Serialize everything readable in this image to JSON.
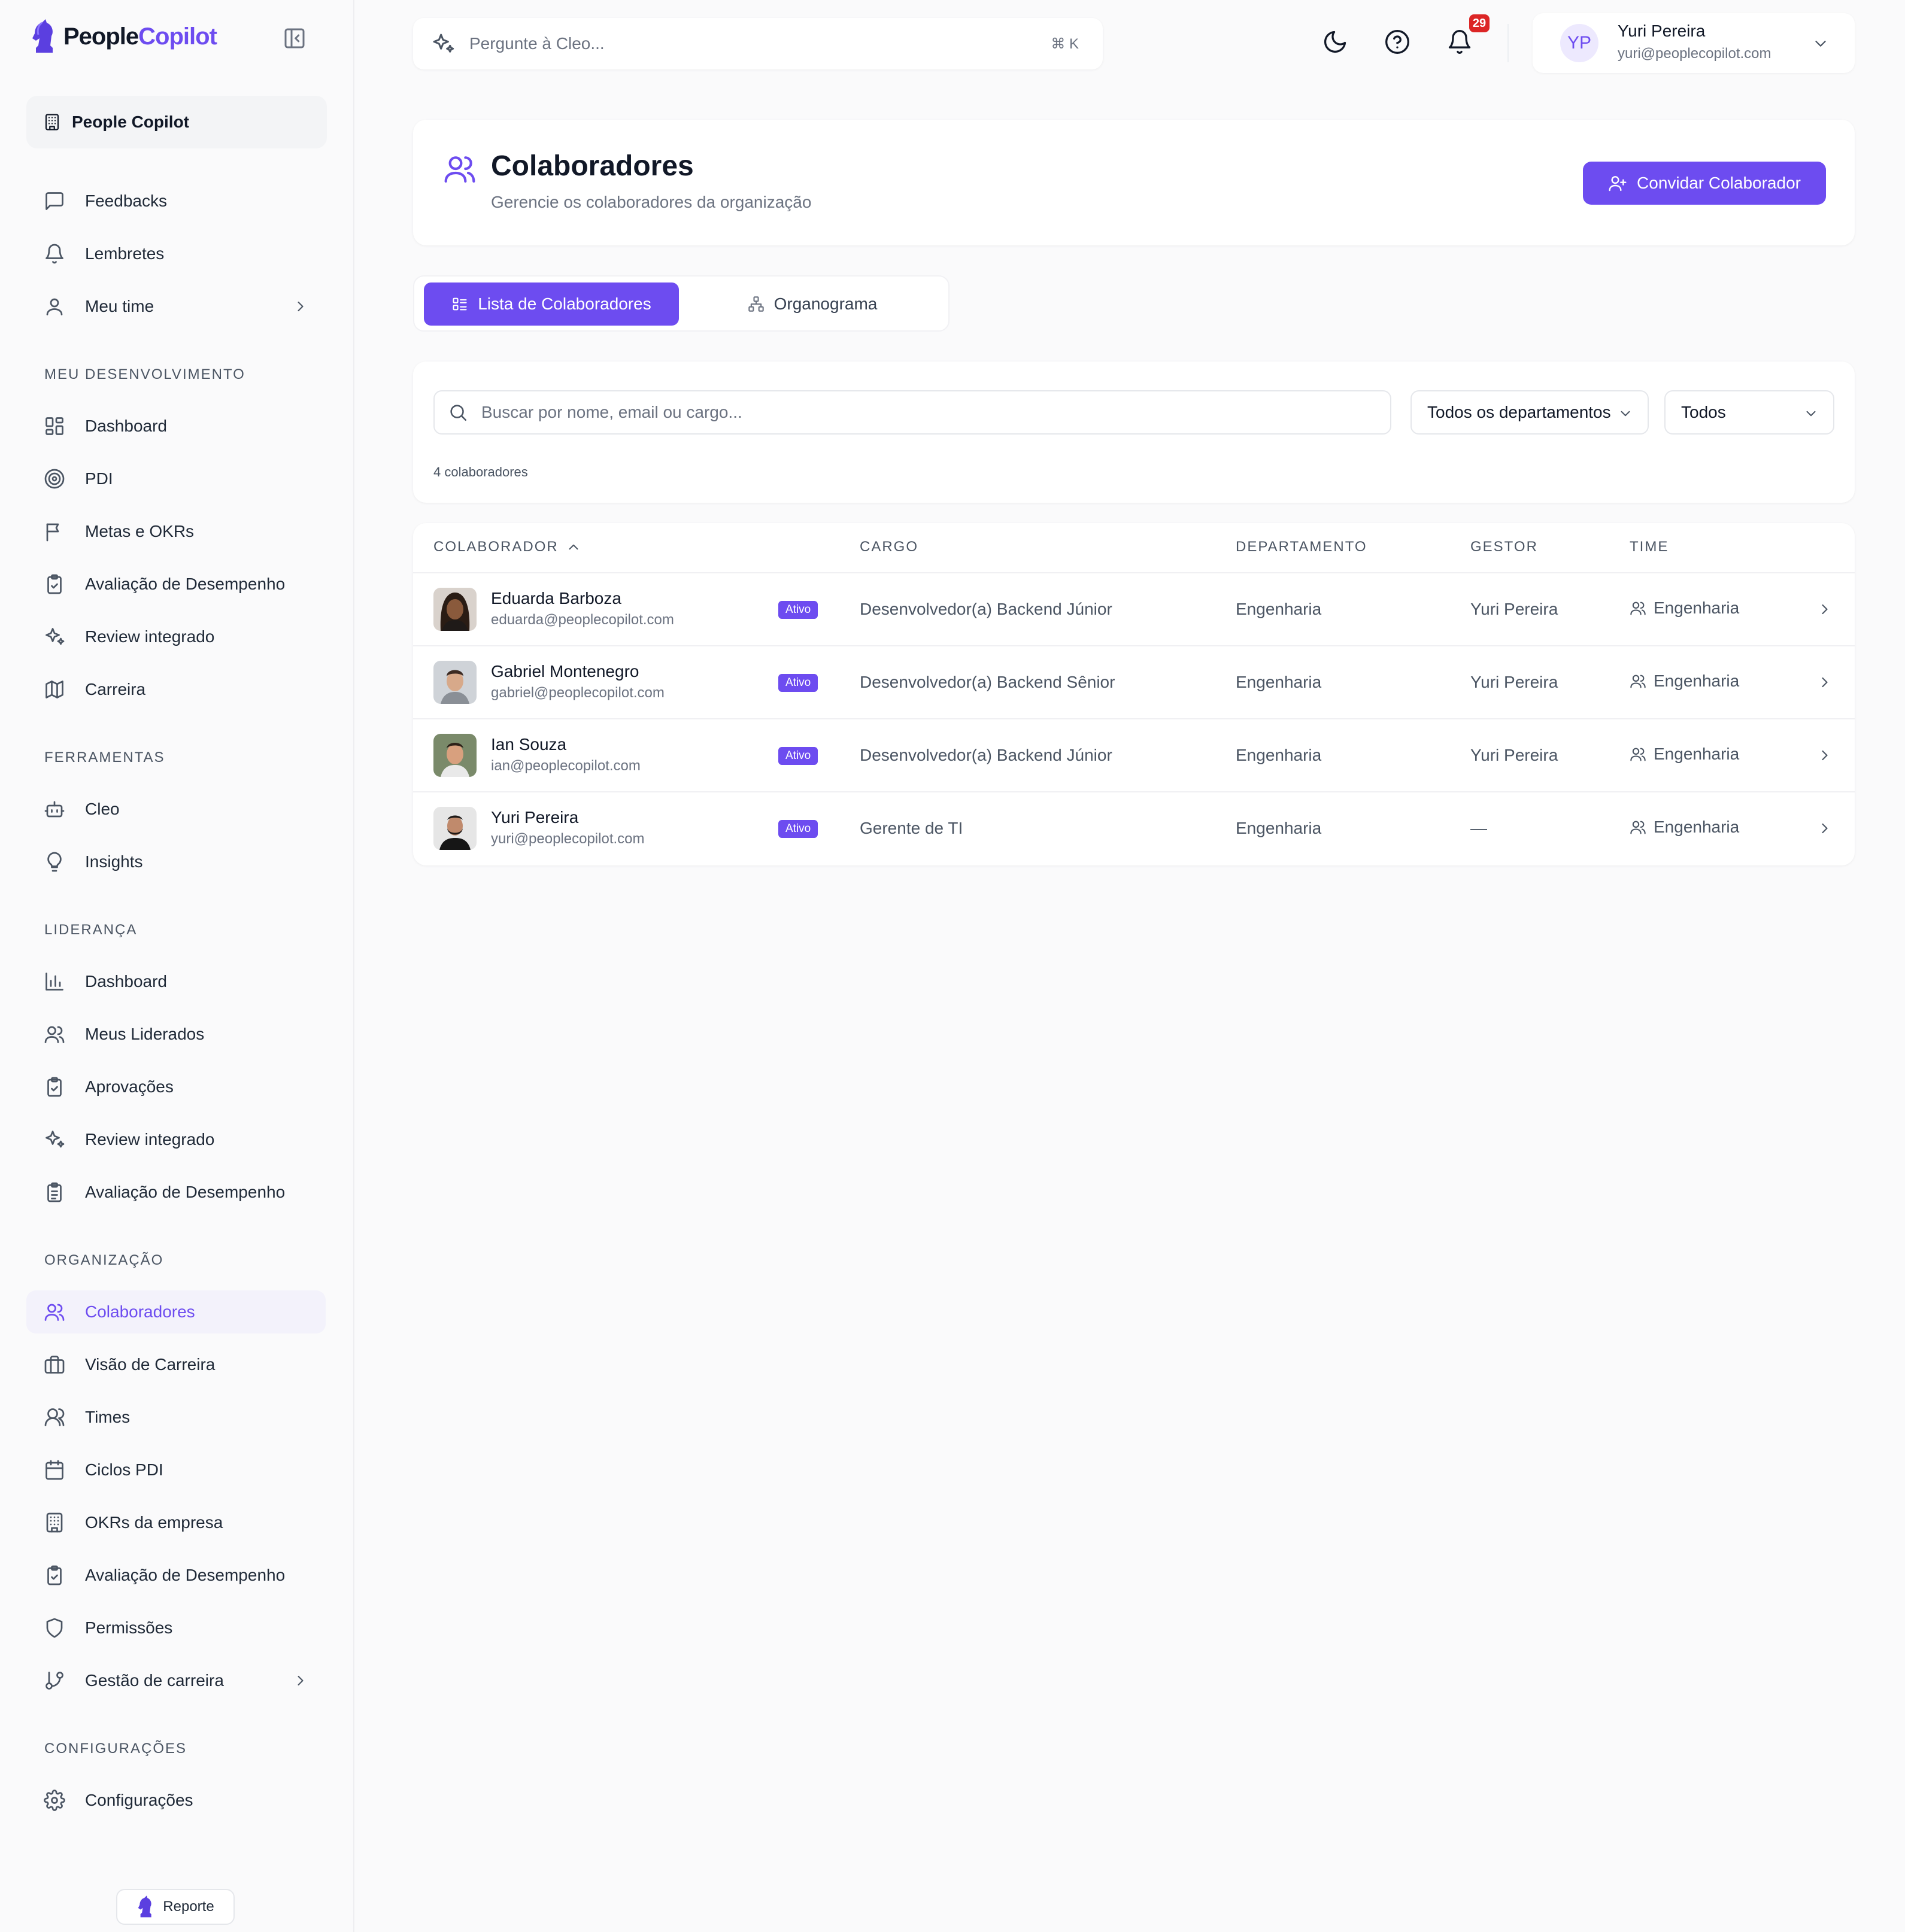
{
  "brand": {
    "name_part1": "People",
    "name_part2": "Copilot",
    "accent": "#6d4cf0"
  },
  "sidebar": {
    "org_name": "People Copilot",
    "top_items": [
      {
        "label": "Feedbacks",
        "icon": "message-square-icon"
      },
      {
        "label": "Lembretes",
        "icon": "bell-icon"
      },
      {
        "label": "Meu time",
        "icon": "user-icon"
      }
    ],
    "sections": {
      "dev": "MEU DESENVOLVIMENTO",
      "tools": "FERRAMENTAS",
      "lead": "LIDERANÇA",
      "org": "ORGANIZAÇÃO",
      "config": "CONFIGURAÇÕES"
    },
    "dev_items": [
      {
        "label": "Dashboard",
        "icon": "layout-dashboard-icon"
      },
      {
        "label": "PDI",
        "icon": "target-icon"
      },
      {
        "label": "Metas e OKRs",
        "icon": "flag-icon"
      },
      {
        "label": "Avaliação de Desempenho",
        "icon": "clipboard-check-icon"
      },
      {
        "label": "Review integrado",
        "icon": "sparkles-icon"
      },
      {
        "label": "Carreira",
        "icon": "map-icon"
      }
    ],
    "tools_items": [
      {
        "label": "Cleo",
        "icon": "bot-icon"
      },
      {
        "label": "Insights",
        "icon": "lightbulb-icon"
      }
    ],
    "lead_items": [
      {
        "label": "Dashboard",
        "icon": "bar-chart-icon"
      },
      {
        "label": "Meus Liderados",
        "icon": "users-icon"
      },
      {
        "label": "Aprovações",
        "icon": "clipboard-check-icon"
      },
      {
        "label": "Review integrado",
        "icon": "sparkles-icon"
      },
      {
        "label": "Avaliação de Desempenho",
        "icon": "clipboard-list-icon"
      }
    ],
    "org_items": [
      {
        "label": "Colaboradores",
        "icon": "users-icon",
        "active": true
      },
      {
        "label": "Visão de Carreira",
        "icon": "briefcase-icon"
      },
      {
        "label": "Times",
        "icon": "users-round-icon"
      },
      {
        "label": "Ciclos PDI",
        "icon": "calendar-icon"
      },
      {
        "label": "OKRs da empresa",
        "icon": "building-icon"
      },
      {
        "label": "Avaliação de Desempenho",
        "icon": "clipboard-check-icon"
      },
      {
        "label": "Permissões",
        "icon": "shield-icon"
      },
      {
        "label": "Gestão de carreira",
        "icon": "git-branch-icon"
      }
    ],
    "config_items": [
      {
        "label": "Configurações",
        "icon": "settings-icon"
      }
    ],
    "report_label": "Reporte"
  },
  "topbar": {
    "search_placeholder": "Pergunte à Cleo...",
    "shortcut": "⌘ K",
    "notifications_count": "29",
    "user": {
      "initials": "YP",
      "name": "Yuri Pereira",
      "email": "yuri@peoplecopilot.com"
    }
  },
  "page": {
    "title": "Colaboradores",
    "subtitle": "Gerencie os colaboradores da organização",
    "invite_label": "Convidar Colaborador",
    "tabs": {
      "list": "Lista de Colaboradores",
      "org": "Organograma"
    },
    "search_placeholder": "Buscar por nome, email ou cargo...",
    "dept_filter": "Todos os departamentos",
    "status_filter": "Todos",
    "count_text": "4 colaboradores"
  },
  "table": {
    "headers": {
      "colaborador": "COLABORADOR",
      "cargo": "CARGO",
      "departamento": "DEPARTAMENTO",
      "gestor": "GESTOR",
      "time": "TIME"
    },
    "rows": [
      {
        "name": "Eduarda Barboza",
        "email": "eduarda@peoplecopilot.com",
        "status": "Ativo",
        "cargo": "Desenvolvedor(a) Backend Júnior",
        "departamento": "Engenharia",
        "gestor": "Yuri Pereira",
        "time": "Engenharia"
      },
      {
        "name": "Gabriel Montenegro",
        "email": "gabriel@peoplecopilot.com",
        "status": "Ativo",
        "cargo": "Desenvolvedor(a) Backend Sênior",
        "departamento": "Engenharia",
        "gestor": "Yuri Pereira",
        "time": "Engenharia"
      },
      {
        "name": "Ian Souza",
        "email": "ian@peoplecopilot.com",
        "status": "Ativo",
        "cargo": "Desenvolvedor(a) Backend Júnior",
        "departamento": "Engenharia",
        "gestor": "Yuri Pereira",
        "time": "Engenharia"
      },
      {
        "name": "Yuri Pereira",
        "email": "yuri@peoplecopilot.com",
        "status": "Ativo",
        "cargo": "Gerente de TI",
        "departamento": "Engenharia",
        "gestor": "—",
        "time": "Engenharia"
      }
    ]
  }
}
